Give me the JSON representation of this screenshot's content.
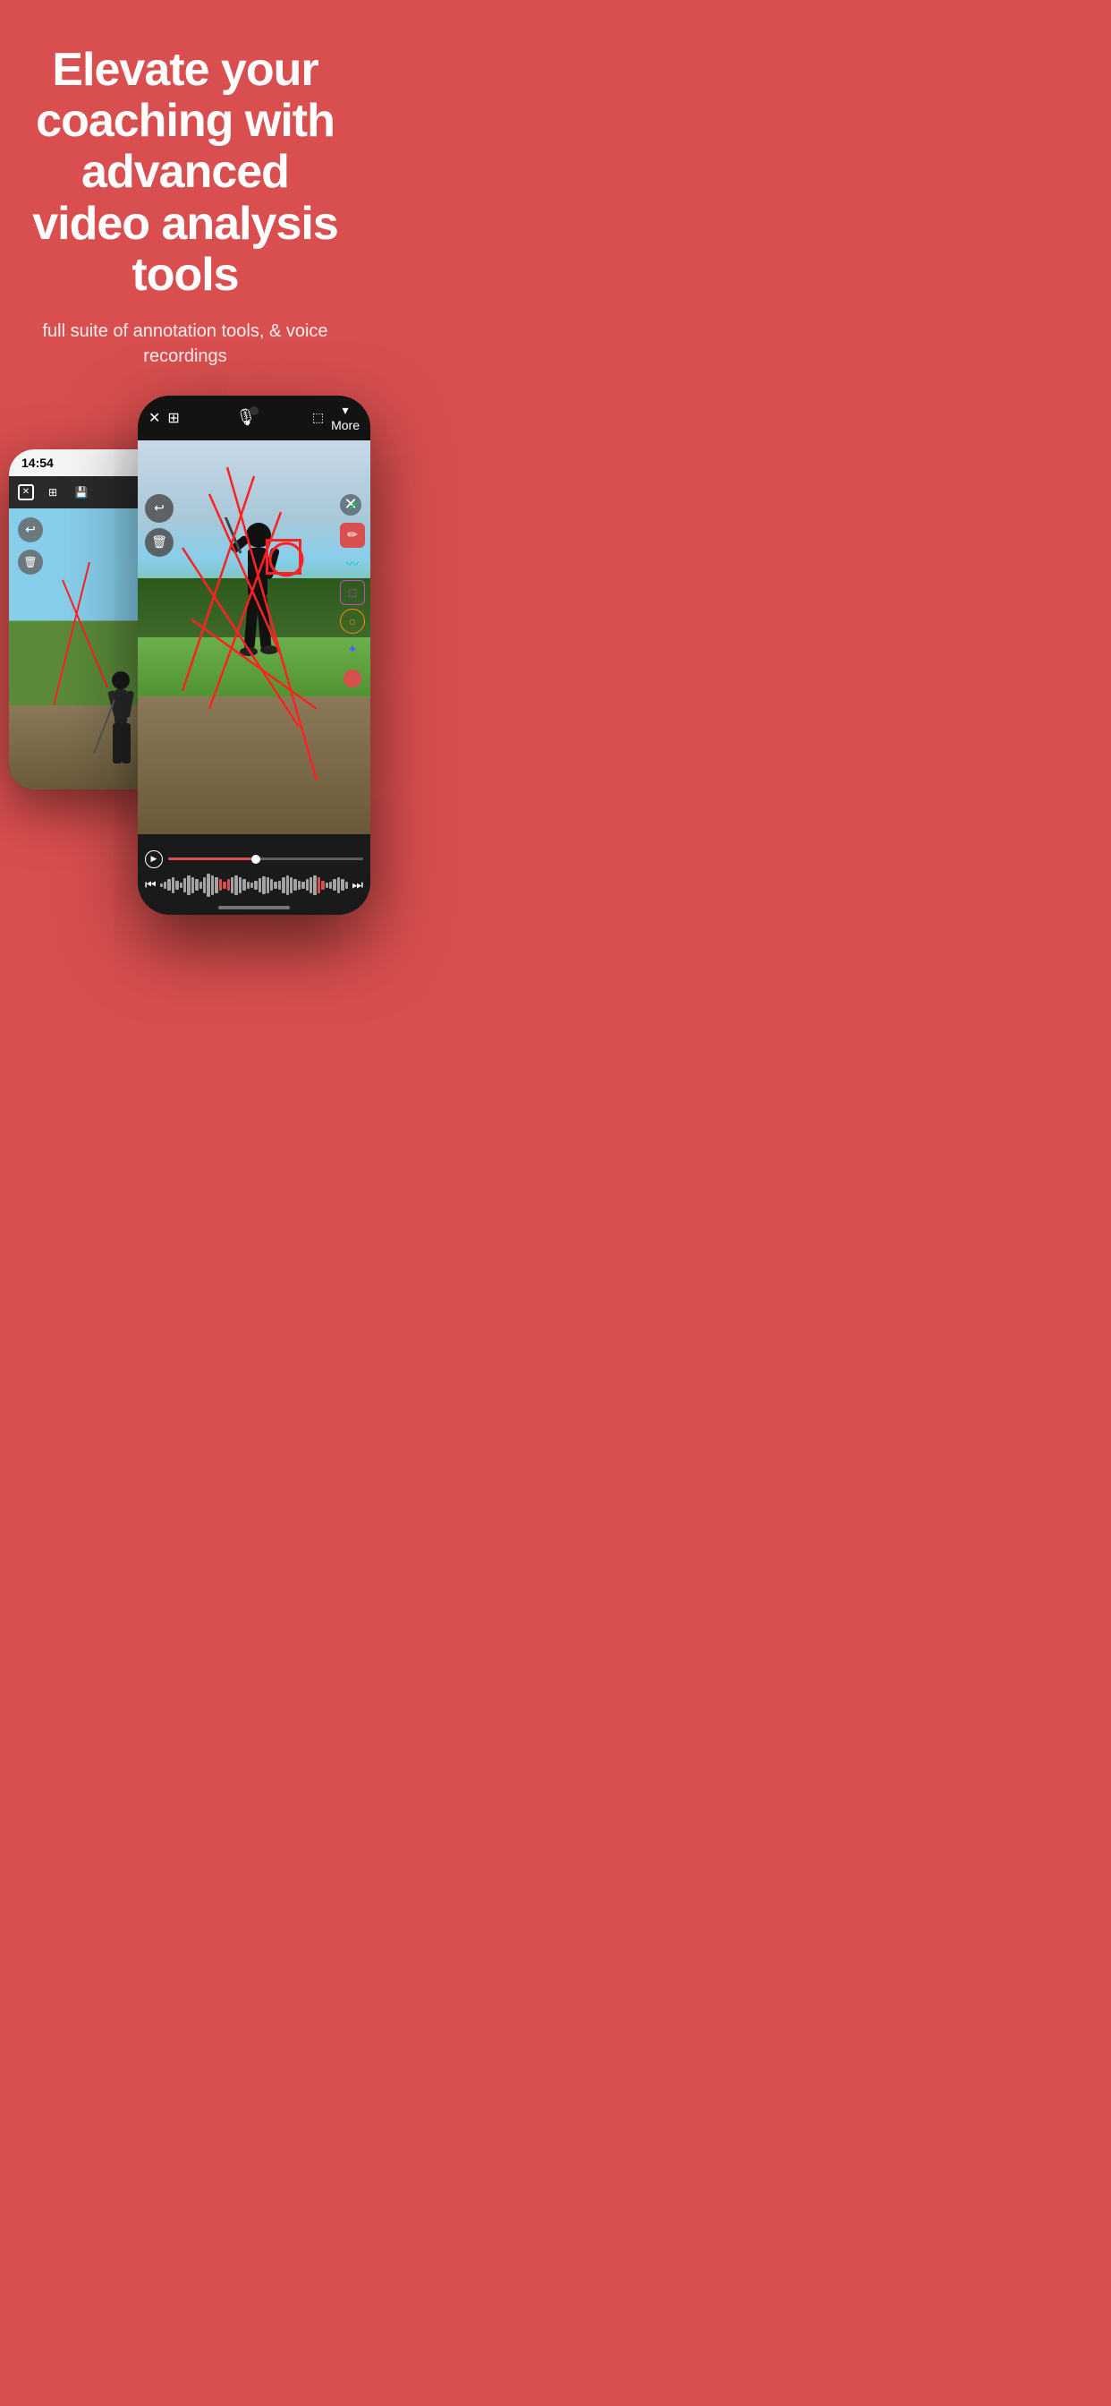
{
  "hero": {
    "headline": "Elevate your coaching with advanced video analysis tools",
    "subheadline": "full suite of annotation tools, & voice recordings",
    "bg_color": "#d94f4f"
  },
  "phone_back": {
    "status_time": "14:54",
    "toolbar_icons": [
      "×",
      "⊞",
      "💾"
    ],
    "tools": {
      "undo": "↩",
      "delete": "🗑"
    }
  },
  "phone_front": {
    "toolbar": {
      "close": "×",
      "grid": "⊞",
      "mic": "🎙",
      "camera": "📷",
      "more_label": "More"
    },
    "tools": {
      "arrow": "↗",
      "pen": "/",
      "wave": "≋",
      "rect": "□",
      "circle": "○",
      "move": "✦",
      "record_label": "●"
    },
    "left_tools": {
      "undo": "↩",
      "delete": "🗑"
    },
    "playback": {
      "play_icon": "▶",
      "skip_back": "⏮",
      "skip_fwd": "⏭"
    }
  },
  "waveform_bars": [
    2,
    4,
    6,
    8,
    5,
    3,
    7,
    10,
    8,
    6,
    4,
    8,
    12,
    10,
    8,
    6,
    4,
    6,
    8,
    10,
    8,
    6,
    4,
    3,
    5,
    7,
    9,
    8,
    6,
    4,
    5,
    8,
    10,
    8,
    6,
    5,
    4,
    6,
    8,
    10,
    8,
    5,
    3,
    4,
    6,
    8,
    6,
    4
  ],
  "waveform_accent_indices": [
    15,
    16,
    17,
    40,
    41
  ]
}
